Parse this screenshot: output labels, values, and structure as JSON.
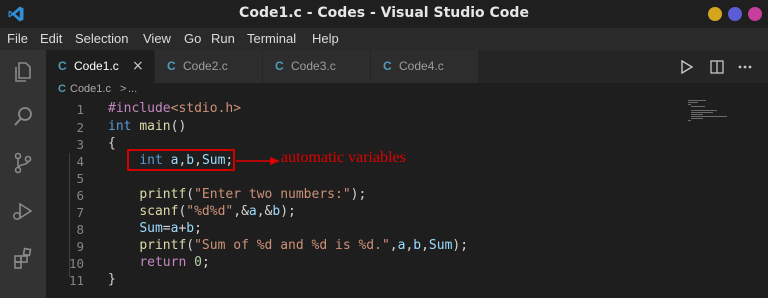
{
  "window": {
    "title": "Code1.c - Codes - Visual Studio Code",
    "controls": {
      "minimize_color": "#d4a51d",
      "maximize_color": "#5c5cd6",
      "close_color": "#c83e9b"
    }
  },
  "menu": [
    "File",
    "Edit",
    "Selection",
    "View",
    "Go",
    "Run",
    "Terminal",
    "Help"
  ],
  "activity_icons": [
    "explorer-icon",
    "search-icon",
    "source-control-icon",
    "run-debug-icon",
    "extensions-icon"
  ],
  "tabs": [
    {
      "icon": "C",
      "label": "Code1.c",
      "active": true,
      "close": "×"
    },
    {
      "icon": "C",
      "label": "Code2.c",
      "active": false
    },
    {
      "icon": "C",
      "label": "Code3.c",
      "active": false
    },
    {
      "icon": "C",
      "label": "Code4.c",
      "active": false
    }
  ],
  "toolbar_icons": [
    "run-icon",
    "split-editor-icon",
    "more-actions-icon"
  ],
  "breadcrumb": {
    "icon": "C",
    "file": "Code1.c",
    "separator": ">",
    "more": "..."
  },
  "code": [
    {
      "ln": "1",
      "tokens": [
        {
          "t": "#include",
          "c": "pp"
        },
        {
          "t": "<stdio.h>",
          "c": "str"
        }
      ]
    },
    {
      "ln": "2",
      "tokens": [
        {
          "t": "int",
          "c": "kw"
        },
        {
          "t": " ",
          "c": "plain"
        },
        {
          "t": "main",
          "c": "fn"
        },
        {
          "t": "()",
          "c": "plain"
        }
      ]
    },
    {
      "ln": "3",
      "tokens": [
        {
          "t": "{",
          "c": "plain"
        }
      ]
    },
    {
      "ln": "4",
      "tokens": [
        {
          "t": "    ",
          "c": "plain"
        },
        {
          "t": "int",
          "c": "kw"
        },
        {
          "t": " ",
          "c": "plain"
        },
        {
          "t": "a",
          "c": "var"
        },
        {
          "t": ",",
          "c": "plain"
        },
        {
          "t": "b",
          "c": "var"
        },
        {
          "t": ",",
          "c": "plain"
        },
        {
          "t": "Sum",
          "c": "var"
        },
        {
          "t": ";",
          "c": "plain"
        }
      ]
    },
    {
      "ln": "5",
      "tokens": []
    },
    {
      "ln": "6",
      "tokens": [
        {
          "t": "    ",
          "c": "plain"
        },
        {
          "t": "printf",
          "c": "fn"
        },
        {
          "t": "(",
          "c": "plain"
        },
        {
          "t": "\"Enter two numbers:\"",
          "c": "str"
        },
        {
          "t": ");",
          "c": "plain"
        }
      ]
    },
    {
      "ln": "7",
      "tokens": [
        {
          "t": "    ",
          "c": "plain"
        },
        {
          "t": "scanf",
          "c": "fn"
        },
        {
          "t": "(",
          "c": "plain"
        },
        {
          "t": "\"%d%d\"",
          "c": "str"
        },
        {
          "t": ",&",
          "c": "plain"
        },
        {
          "t": "a",
          "c": "var"
        },
        {
          "t": ",&",
          "c": "plain"
        },
        {
          "t": "b",
          "c": "var"
        },
        {
          "t": ");",
          "c": "plain"
        }
      ]
    },
    {
      "ln": "8",
      "tokens": [
        {
          "t": "    ",
          "c": "plain"
        },
        {
          "t": "Sum",
          "c": "var"
        },
        {
          "t": "=",
          "c": "plain"
        },
        {
          "t": "a",
          "c": "var"
        },
        {
          "t": "+",
          "c": "plain"
        },
        {
          "t": "b",
          "c": "var"
        },
        {
          "t": ";",
          "c": "plain"
        }
      ]
    },
    {
      "ln": "9",
      "tokens": [
        {
          "t": "    ",
          "c": "plain"
        },
        {
          "t": "printf",
          "c": "fn"
        },
        {
          "t": "(",
          "c": "plain"
        },
        {
          "t": "\"Sum of %d and %d is %d.\"",
          "c": "str"
        },
        {
          "t": ",",
          "c": "plain"
        },
        {
          "t": "a",
          "c": "var"
        },
        {
          "t": ",",
          "c": "plain"
        },
        {
          "t": "b",
          "c": "var"
        },
        {
          "t": ",",
          "c": "plain"
        },
        {
          "t": "Sum",
          "c": "var"
        },
        {
          "t": ");",
          "c": "plain"
        }
      ]
    },
    {
      "ln": "10",
      "tokens": [
        {
          "t": "    ",
          "c": "plain"
        },
        {
          "t": "return",
          "c": "pp"
        },
        {
          "t": " ",
          "c": "plain"
        },
        {
          "t": "0",
          "c": "num"
        },
        {
          "t": ";",
          "c": "plain"
        }
      ]
    },
    {
      "ln": "11",
      "tokens": [
        {
          "t": "}",
          "c": "plain"
        }
      ]
    }
  ],
  "annotation": {
    "text": "automatic variables",
    "color": "#e00000"
  }
}
